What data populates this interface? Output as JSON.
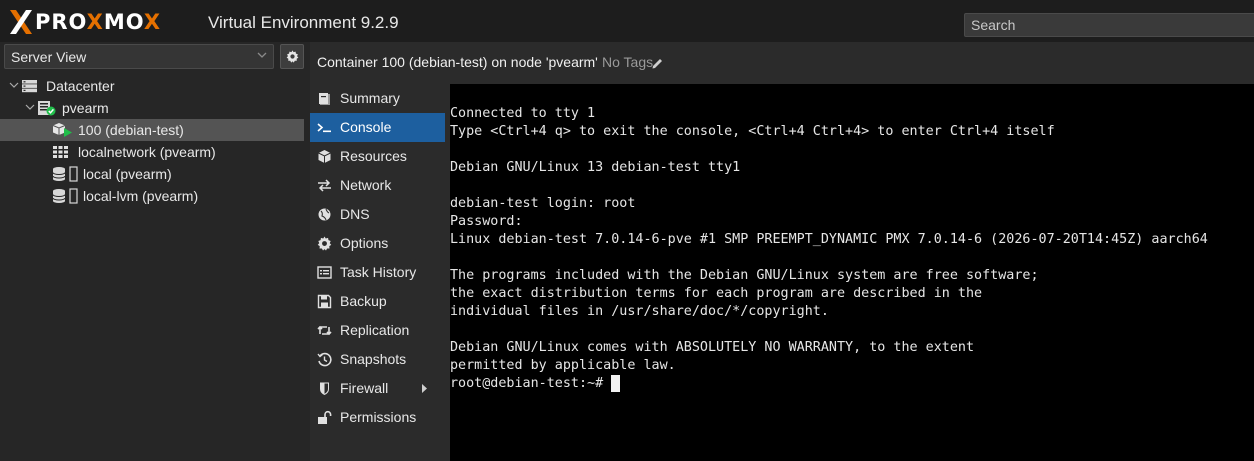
{
  "brand": {
    "wordmark_parts": [
      "PRO",
      "X",
      "MO",
      "X"
    ],
    "accent_color": "#e57000"
  },
  "header": {
    "app_title": "Virtual Environment 9.2.9",
    "search_placeholder": "Search"
  },
  "left_panel": {
    "view_select": {
      "value": "Server View"
    },
    "tree": [
      {
        "label": "Datacenter",
        "icon": "datacenter-icon"
      },
      {
        "label": "pvearm",
        "icon": "node-online-icon"
      },
      {
        "label": "100 (debian-test)",
        "icon": "container-running-icon",
        "selected": true
      },
      {
        "label": "localnetwork (pvearm)",
        "icon": "sdn-network-icon"
      },
      {
        "label": "local (pvearm)",
        "icon": "storage-icon"
      },
      {
        "label": "local-lvm (pvearm)",
        "icon": "storage-icon"
      }
    ]
  },
  "main": {
    "title": "Container 100 (debian-test) on node 'pvearm'",
    "tags_label": "No Tags",
    "menu": [
      {
        "label": "Summary",
        "icon": "book-icon"
      },
      {
        "label": "Console",
        "icon": "terminal-icon",
        "active": true
      },
      {
        "label": "Resources",
        "icon": "cube-icon"
      },
      {
        "label": "Network",
        "icon": "exchange-icon"
      },
      {
        "label": "DNS",
        "icon": "globe-icon"
      },
      {
        "label": "Options",
        "icon": "gear-icon"
      },
      {
        "label": "Task History",
        "icon": "list-alt-icon"
      },
      {
        "label": "Backup",
        "icon": "floppy-icon"
      },
      {
        "label": "Replication",
        "icon": "retweet-icon"
      },
      {
        "label": "Snapshots",
        "icon": "history-icon"
      },
      {
        "label": "Firewall",
        "icon": "shield-icon",
        "has_submenu": true
      },
      {
        "label": "Permissions",
        "icon": "unlock-icon"
      }
    ]
  },
  "console": {
    "lines": [
      "Connected to tty 1",
      "Type <Ctrl+4 q> to exit the console, <Ctrl+4 Ctrl+4> to enter Ctrl+4 itself",
      "",
      "Debian GNU/Linux 13 debian-test tty1",
      "",
      "debian-test login: root",
      "Password:",
      "Linux debian-test 7.0.14-6-pve #1 SMP PREEMPT_DYNAMIC PMX 7.0.14-6 (2026-07-20T14:45Z) aarch64",
      "",
      "The programs included with the Debian GNU/Linux system are free software;",
      "the exact distribution terms for each program are described in the",
      "individual files in /usr/share/doc/*/copyright.",
      "",
      "Debian GNU/Linux comes with ABSOLUTELY NO WARRANTY, to the extent",
      "permitted by applicable law."
    ],
    "prompt": "root@debian-test:~#"
  }
}
